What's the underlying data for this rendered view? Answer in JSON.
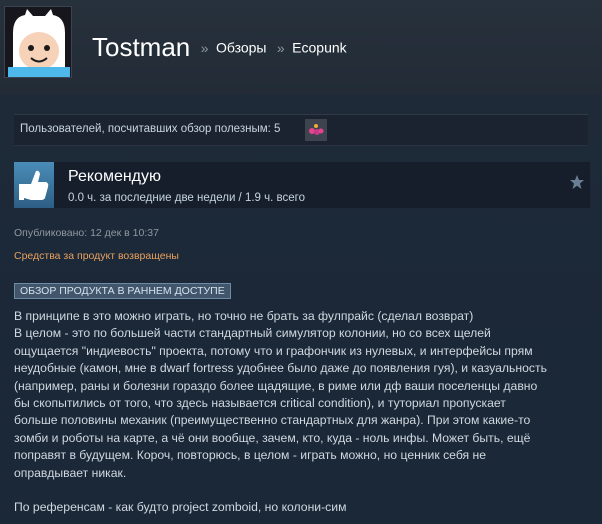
{
  "header": {
    "user_name": "Tostman",
    "sep1": "»",
    "crumb_reviews": "Обзоры",
    "sep2": "»",
    "crumb_game": "Ecopunk"
  },
  "helpful": {
    "text": "Пользователей, посчитавших обзор полезным: 5",
    "award_icon": "award-icon"
  },
  "recommendation": {
    "title": "Рекомендую",
    "hours": "0.0 ч. за последние две недели / 1.9 ч. всего",
    "thumb_icon": "thumbs-up-icon",
    "star_icon": "star-icon"
  },
  "meta": {
    "posted": "Опубликовано: 12 дек в 10:37",
    "refund": "Средства за продукт возвращены"
  },
  "badge": "ОБЗОР ПРОДУКТА В РАННЕМ ДОСТУПЕ",
  "review": {
    "lines": [
      "В принципе в это можно играть, но точно не брать за фулпрайс (сделал возврат)",
      "В целом - это по большей части стандартный симулятор колонии, но со всех щелей",
      "ощущается \"индиевость\" проекта, потому что и графончик из нулевых, и интерфейсы прям",
      "неудобные (камон, мне в dwarf fortress удобнее было даже до появления гуя), и казуальность",
      "(например, раны и болезни гораздо более щадящие, в риме или дф ваши поселенцы давно",
      "бы скопытились от того, что здесь называется critical condition), и туториал пропускает",
      "больше половины механик (преимущественно стандартных для жанра). При этом какие-то",
      "зомби и роботы на карте, а чё они вообще, зачем, кто, куда - ноль инфы. Может быть, ещё",
      "поправят в будущем. Короч, повторюсь, в целом - играть можно, но ценник себя не",
      "оправдывает никак."
    ],
    "last_line": "По референсам - как будто project zomboid, но колони-сим"
  },
  "colors": {
    "background": "#1b2838",
    "refund": "#e8a15f",
    "thumb": "#4a8db8"
  }
}
